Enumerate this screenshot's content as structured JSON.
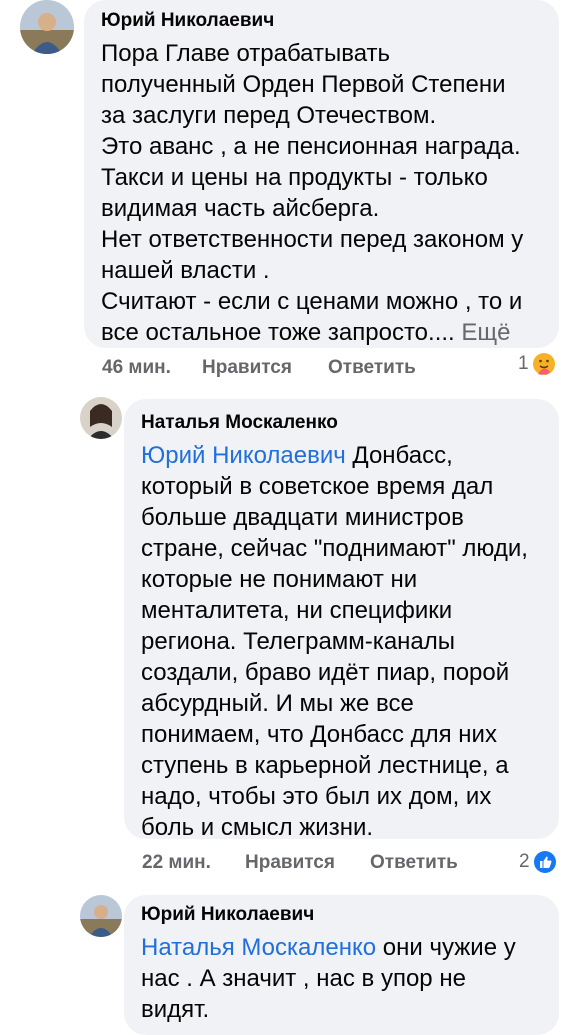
{
  "comments": [
    {
      "author": "Юрий Николаевич",
      "text": "Пора Главе отрабатывать\nполученный Орден Первой Степени\nза заслуги перед Отечеством.\nЭто аванс , а не пенсионная награда.\nТакси и цены на продукты - только\nвидимая часть айсберга.\nНет ответственности перед законом у\nнашей власти .\nСчитают - если с ценами можно , то и\nвсе остальное тоже запросто....",
      "more": "Ещё",
      "time": "46 мин.",
      "like_label": "Нравится",
      "reply_label": "Ответить",
      "reaction_count": "1",
      "reaction_icon": "care-emoji-icon"
    },
    {
      "author": "Наталья Москаленко",
      "mention": "Юрий Николаевич",
      "text": " Донбасс,\nкоторый в советское время дал\nбольше двадцати министров\nстране, сейчас \"поднимают\" люди,\nкоторые не понимают ни\nменталитета, ни специфики\nрегиона. Телеграмм-каналы\nсоздали,  браво идёт пиар, порой\nабсурдный. И мы же все\nпонимаем, что Донбасс для них\nступень в карьерной лестнице, а\nнадо, чтобы это был их дом, их\nболь и смысл жизни.",
      "time": "22 мин.",
      "like_label": "Нравится",
      "reply_label": "Ответить",
      "reaction_count": "2",
      "reaction_icon": "like-icon"
    },
    {
      "author": "Юрий Николаевич",
      "mention": "Наталья Москаленко",
      "text": " они чужие у\nнас . А значит , нас в упор не\nвидят."
    }
  ],
  "colors": {
    "bubble": "#f0f2f5",
    "mention": "#216fdb",
    "meta": "#65676b",
    "like": "#1877f2"
  }
}
